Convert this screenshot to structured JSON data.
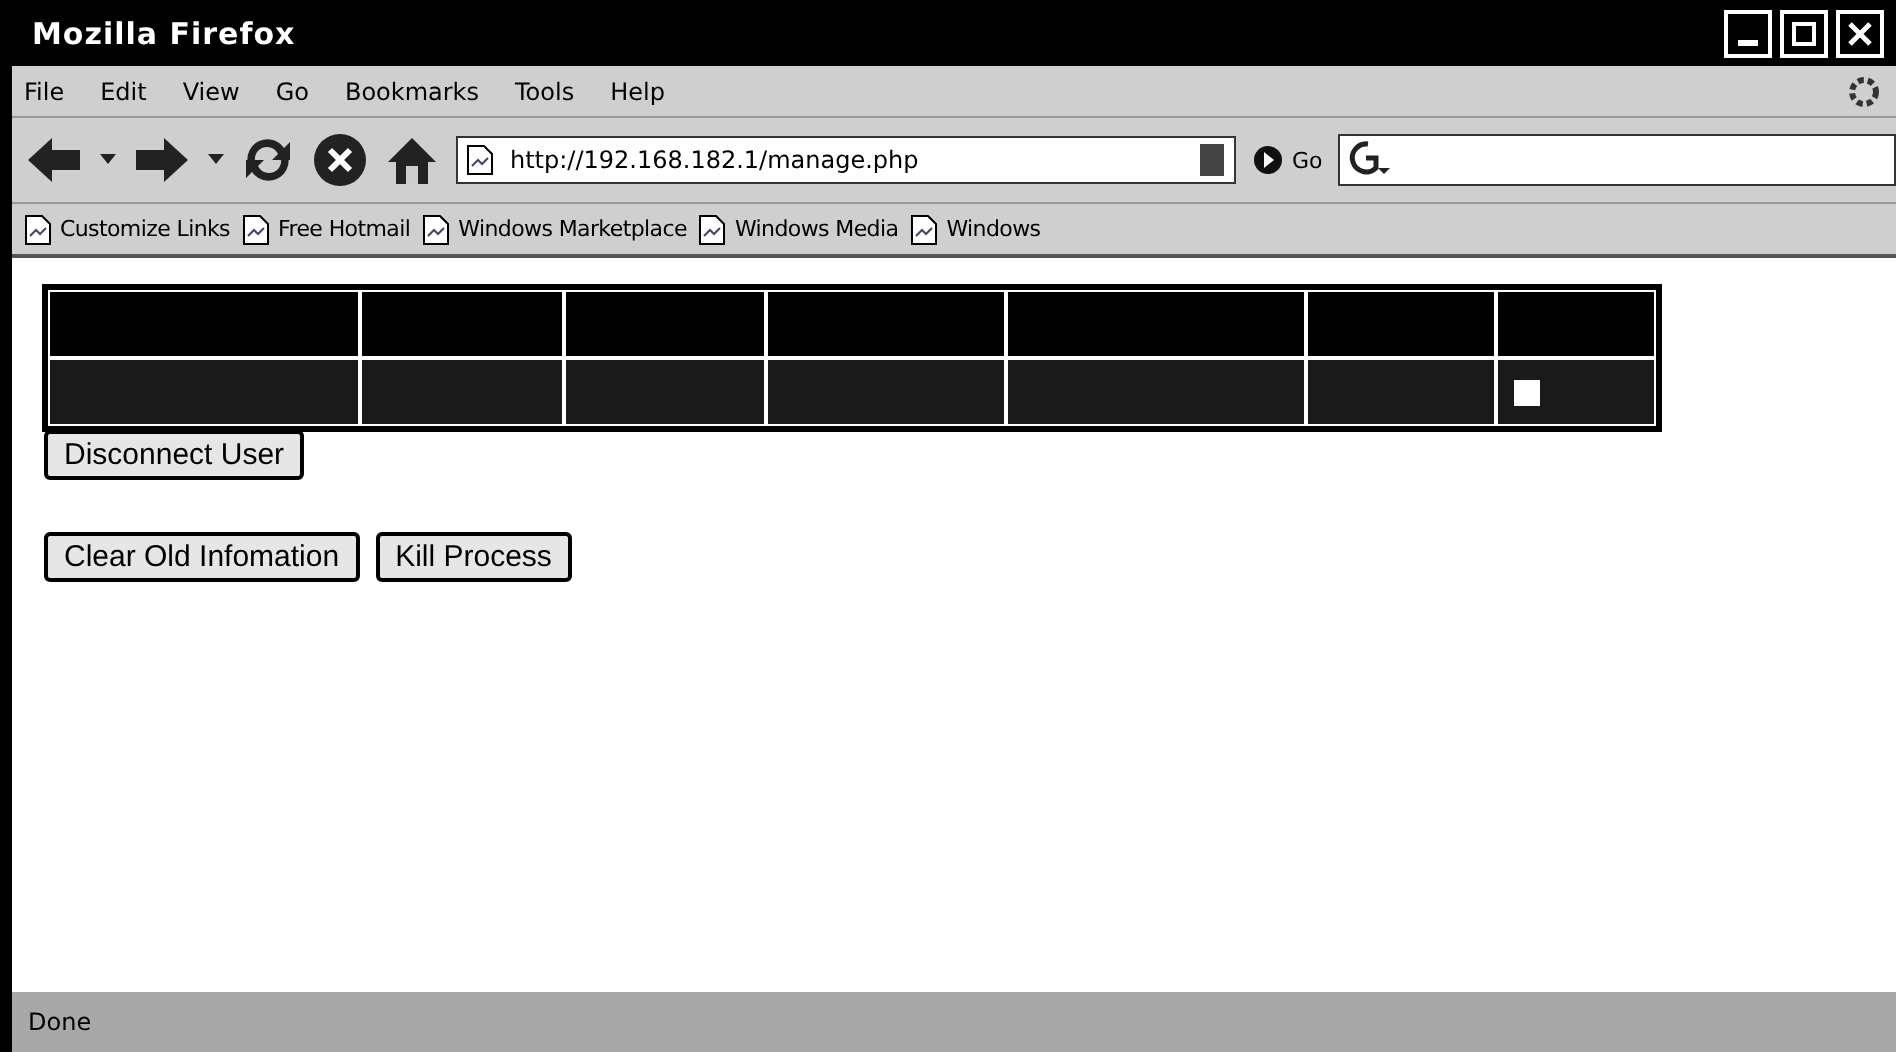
{
  "window": {
    "title": "Mozilla Firefox"
  },
  "menu": [
    "File",
    "Edit",
    "View",
    "Go",
    "Bookmarks",
    "Tools",
    "Help"
  ],
  "address": {
    "value": "http://192.168.182.1/manage.php"
  },
  "go_button": "Go",
  "bookmarks": [
    "Customize Links",
    "Free Hotmail",
    "Windows Marketplace",
    "Windows Media",
    "Windows"
  ],
  "table": {
    "rows": [
      {
        "checked": false
      }
    ]
  },
  "buttons": [
    {
      "label": "Disconnect User"
    },
    {
      "label": "Clear Old Infomation"
    },
    {
      "label": "Kill Process"
    }
  ],
  "status_bar": {
    "text": "Done"
  }
}
